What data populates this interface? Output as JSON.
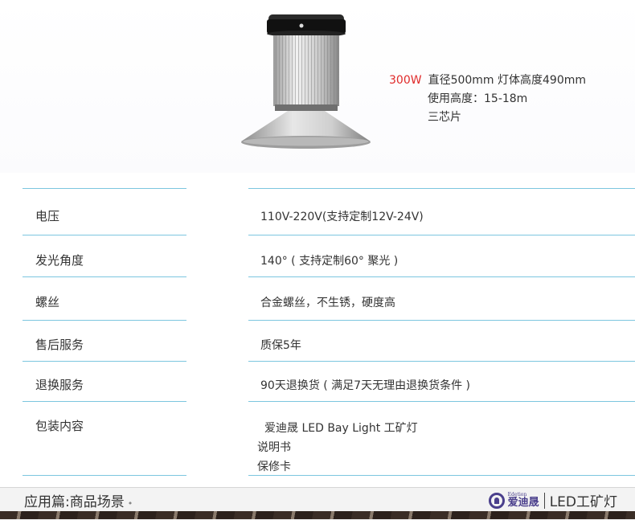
{
  "product": {
    "watt": "300W",
    "spec_line1": "直径500mm  灯体高度490mm",
    "spec_line2": "使用高度：15-18m",
    "spec_line3": "三芯片"
  },
  "specs": [
    {
      "label": "电压",
      "value": "110V-220V(支持定制12V-24V)"
    },
    {
      "label": "发光角度",
      "value": "140°  ( 支持定制60°  聚光 )"
    },
    {
      "label": "螺丝",
      "value": "合金螺丝，不生锈，硬度高"
    },
    {
      "label": "售后服务",
      "value": "质保5年"
    },
    {
      "label": "退换服务",
      "value": "90天退换货 ( 满足7天无理由退换货条件 )"
    },
    {
      "label": "包装内容",
      "values": [
        "爱迪晟 LED Bay Light 工矿灯",
        "说明书",
        "保修卡"
      ]
    }
  ],
  "footer": {
    "section_title": "应用篇:商品场景",
    "dot": "•",
    "brand_small": "Edetion",
    "brand_cn": "爱迪晟",
    "product_name": "LED工矿灯"
  }
}
